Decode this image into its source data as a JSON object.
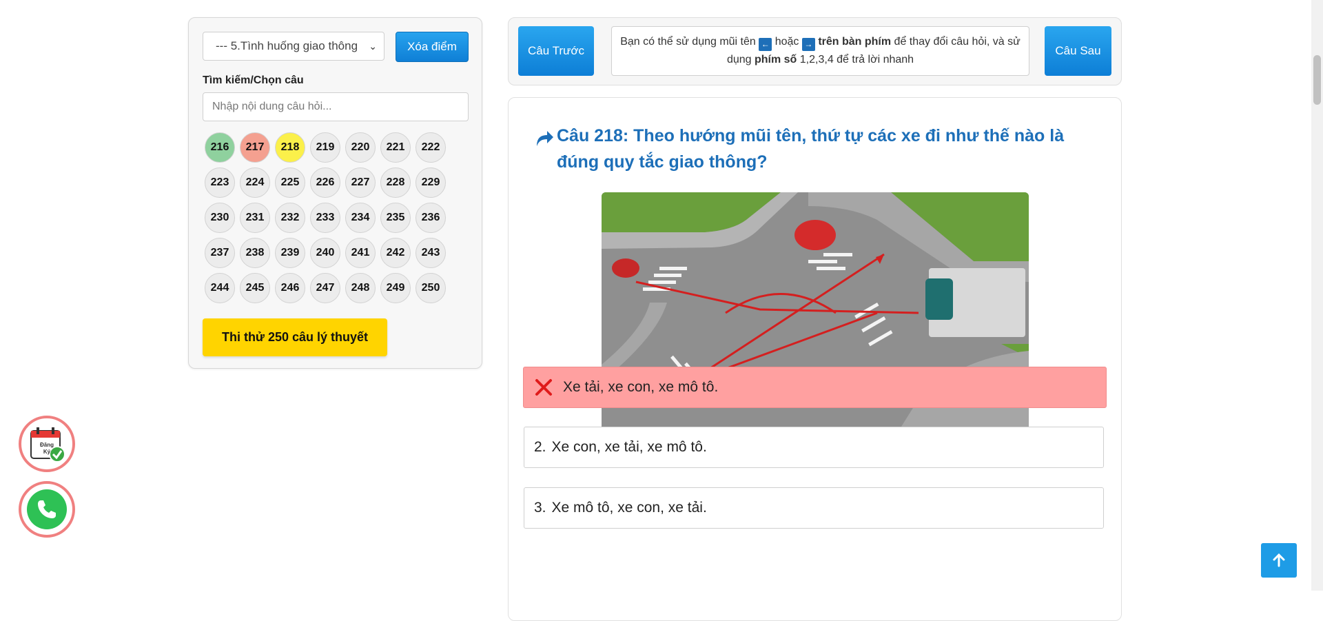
{
  "sidebar": {
    "topic_select_value": "--- 5.Tình huống giao thông",
    "clear_button": "Xóa điểm",
    "search_label": "Tìm kiếm/Chọn câu",
    "search_placeholder": "Nhập nội dung câu hỏi...",
    "question_numbers": [
      {
        "n": "216",
        "status": "correct"
      },
      {
        "n": "217",
        "status": "wrong"
      },
      {
        "n": "218",
        "status": "current"
      },
      {
        "n": "219",
        "status": "none"
      },
      {
        "n": "220",
        "status": "none"
      },
      {
        "n": "221",
        "status": "none"
      },
      {
        "n": "222",
        "status": "none"
      },
      {
        "n": "223",
        "status": "none"
      },
      {
        "n": "224",
        "status": "none"
      },
      {
        "n": "225",
        "status": "none"
      },
      {
        "n": "226",
        "status": "none"
      },
      {
        "n": "227",
        "status": "none"
      },
      {
        "n": "228",
        "status": "none"
      },
      {
        "n": "229",
        "status": "none"
      },
      {
        "n": "230",
        "status": "none"
      },
      {
        "n": "231",
        "status": "none"
      },
      {
        "n": "232",
        "status": "none"
      },
      {
        "n": "233",
        "status": "none"
      },
      {
        "n": "234",
        "status": "none"
      },
      {
        "n": "235",
        "status": "none"
      },
      {
        "n": "236",
        "status": "none"
      },
      {
        "n": "237",
        "status": "none"
      },
      {
        "n": "238",
        "status": "none"
      },
      {
        "n": "239",
        "status": "none"
      },
      {
        "n": "240",
        "status": "none"
      },
      {
        "n": "241",
        "status": "none"
      },
      {
        "n": "242",
        "status": "none"
      },
      {
        "n": "243",
        "status": "none"
      },
      {
        "n": "244",
        "status": "none"
      },
      {
        "n": "245",
        "status": "none"
      },
      {
        "n": "246",
        "status": "none"
      },
      {
        "n": "247",
        "status": "none"
      },
      {
        "n": "248",
        "status": "none"
      },
      {
        "n": "249",
        "status": "none"
      },
      {
        "n": "250",
        "status": "none"
      }
    ],
    "test_button": "Thi thử 250 câu lý thuyết"
  },
  "nav": {
    "prev_button": "Câu Trước",
    "next_button": "Câu Sau",
    "hint_part1": "Bạn có thể sử dụng mũi tên",
    "hint_or": "hoặc",
    "hint_keyboard": "trên bàn phím",
    "hint_part2": "để thay đổi câu hỏi, và sử dụng",
    "hint_numkeys": "phím số",
    "hint_part3": "1,2,3,4 để trả lời nhanh",
    "key_left": "←",
    "key_right": "→"
  },
  "question": {
    "title": "Câu 218: Theo hướng mũi tên, thứ tự các xe đi như thế nào là đúng quy tắc giao thông?",
    "answers": [
      {
        "number": "",
        "text": "Xe tải, xe con, xe mô tô.",
        "state": "wrong"
      },
      {
        "number": "2.",
        "text": "Xe con, xe tải, xe mô tô.",
        "state": "none"
      },
      {
        "number": "3.",
        "text": "Xe mô tô, xe con, xe tải.",
        "state": "none"
      }
    ]
  },
  "floating": {
    "register_label_1": "Đăng",
    "register_label_2": "Ký"
  },
  "colors": {
    "accent_blue": "#1e9ce6",
    "title_blue": "#1d6fb8",
    "correct_green": "#8fd19e",
    "wrong_red": "#f4a090",
    "current_yellow": "#fbf04a",
    "wrong_answer_bg": "#ffa0a0",
    "test_button_yellow": "#ffd400"
  }
}
